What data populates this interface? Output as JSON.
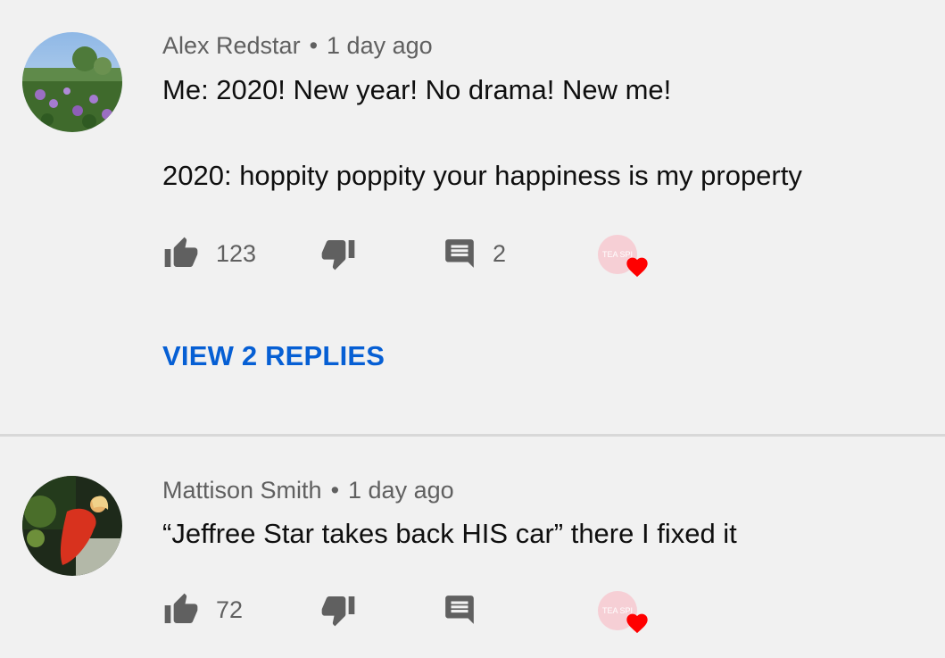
{
  "comments": [
    {
      "author": "Alex Redstar",
      "time": "1 day ago",
      "text": "Me: 2020! New year! No drama! New me!\n\n2020: hoppity poppity your happiness is my property",
      "likes": "123",
      "replies_count": "2",
      "view_replies_label": "VIEW 2 REPLIES",
      "creator_badge_text": "TEA SPI"
    },
    {
      "author": "Mattison Smith",
      "time": "1 day ago",
      "text": "“Jeffree Star takes back HIS car” there I fixed it",
      "likes": "72",
      "creator_badge_text": "TEA SPI"
    }
  ],
  "separator": "•",
  "colors": {
    "background": "#f1f1f1",
    "link_blue": "#065fd4",
    "heart_red": "#ff0000",
    "secondary_text": "#606060",
    "icon_gray": "#606060"
  },
  "icons": [
    "thumbs-up-icon",
    "thumbs-down-icon",
    "reply-comment-icon",
    "heart-icon"
  ]
}
